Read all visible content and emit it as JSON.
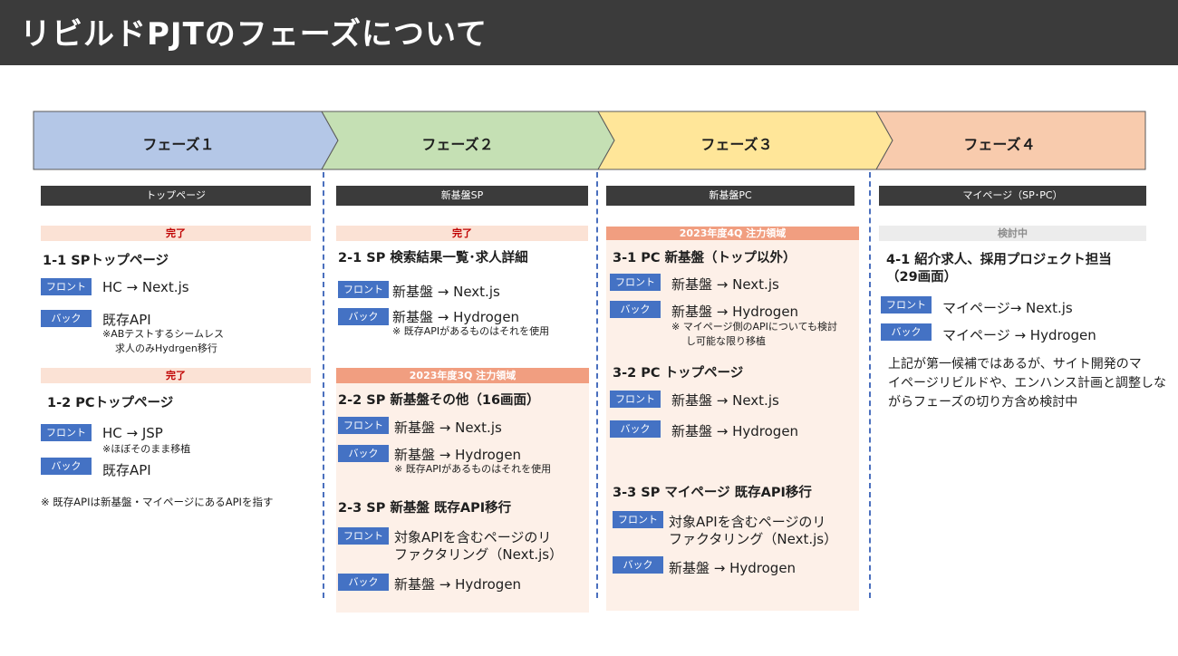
{
  "title": "リビルドPJTのフェーズについて",
  "phases": [
    {
      "label": "フェーズ１",
      "color": "#b4c7e7"
    },
    {
      "label": "フェーズ２",
      "color": "#c5e0b4"
    },
    {
      "label": "フェーズ３",
      "color": "#ffe699"
    },
    {
      "label": "フェーズ４",
      "color": "#f8cbad"
    }
  ],
  "labels": {
    "front": "フロント",
    "back": "バック"
  },
  "col1": {
    "header": "トップページ",
    "status1": "完了",
    "h1": "1-1 SPトップページ",
    "front1": "HC → Next.js",
    "back1": "既存API",
    "note1a": "※ABテストするシームレス",
    "note1b": "求人のみHydrgen移行",
    "status2": "完了",
    "h2": "1-2 PCトップページ",
    "front2": "HC →  JSP",
    "note2": "※ほぼそのまま移植",
    "back2": "既存API",
    "footnote": "※ 既存APIは新基盤・マイページにあるAPIを指す"
  },
  "col2": {
    "header": "新基盤SP",
    "status1": "完了",
    "h1": "2-1 SP 検索結果一覧･求人詳細",
    "front1": "新基盤 → Next.js",
    "back1": "新基盤 → Hydrogen",
    "note1": "※ 既存APIがあるものはそれを使用",
    "focus": "2023年度3Q 注力領域",
    "h2": "2-2 SP 新基盤その他（16画面）",
    "front2": "新基盤 → Next.js",
    "back2": "新基盤 → Hydrogen",
    "note2": "※ 既存APIがあるものはそれを使用",
    "h3": "2-3 SP 新基盤 既存API移行",
    "front3a": "対象APIを含むページのリ",
    "front3b": "ファクタリング（Next.js）",
    "back3": "新基盤 → Hydrogen"
  },
  "col3": {
    "header": "新基盤PC",
    "focus": "2023年度4Q 注力領域",
    "h1": "3-1 PC 新基盤（トップ以外）",
    "front1": "新基盤 → Next.js",
    "back1": "新基盤 → Hydrogen",
    "note1a": "※ マイページ側のAPIについても検討",
    "note1b": "し可能な限り移植",
    "h2": "3-2 PC トップページ",
    "front2": "新基盤 → Next.js",
    "back2": "新基盤 → Hydrogen",
    "h3": "3-3 SP マイページ 既存API移行",
    "front3a": "対象APIを含むページのリ",
    "front3b": "ファクタリング（Next.js）",
    "back3": "新基盤 → Hydrogen"
  },
  "col4": {
    "header": "マイページ（SP･PC）",
    "status": "検討中",
    "h1a": "4-1 紹介求人、採用プロジェクト担当",
    "h1b": "（29画面）",
    "front1": "マイページ→ Next.js",
    "back1": "マイページ → Hydrogen",
    "para1": "上記が第一候補ではあるが、サイト開発のマ",
    "para2": "イページリビルドや、エンハンス計画と調整しな",
    "para3": "がらフェーズの切り方含め検討中"
  }
}
